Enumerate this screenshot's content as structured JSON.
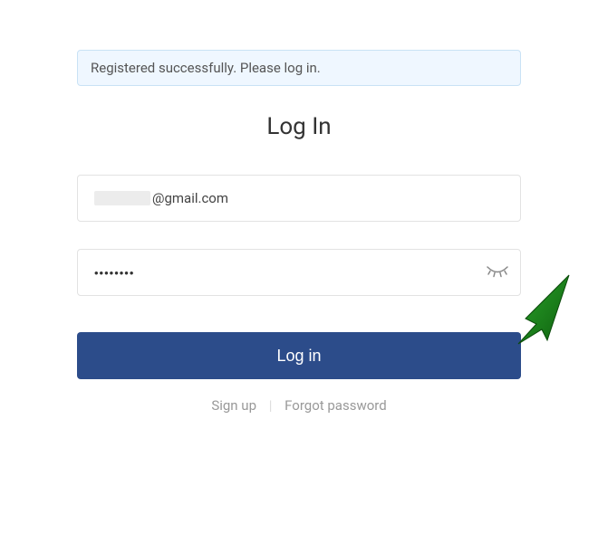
{
  "alert": {
    "message": "Registered successfully. Please log in."
  },
  "title": "Log In",
  "email": {
    "domain": "@gmail.com"
  },
  "password": {
    "masked_value": "••••••••"
  },
  "button": {
    "login_label": "Log in"
  },
  "links": {
    "signup": "Sign up",
    "forgot": "Forgot password",
    "separator": "|"
  },
  "colors": {
    "primary": "#2c4c8a",
    "alert_bg": "#eff7ff",
    "alert_border": "#c9e2f5",
    "arrow": "#1c7a1c"
  }
}
